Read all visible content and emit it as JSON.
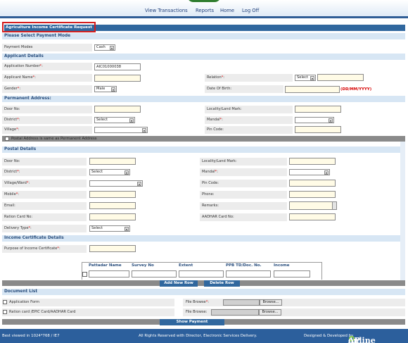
{
  "nav": {
    "view_transactions": "View Transactions",
    "reports": "Reports",
    "home": "Home",
    "log_off": "Log Off"
  },
  "page_title": "Agriculture Income Certificate Request",
  "payment": {
    "section": "Please Select Payment Mode",
    "mode_label": "Payment Modes",
    "mode_value": "Cash"
  },
  "applicant": {
    "section": "Applicant Details",
    "app_number_label": "Application Number",
    "app_number_value": "AIC01000038",
    "name_label": "Applicant Name",
    "relation_label": "Relation",
    "relation_value": "Select",
    "gender_label": "Gender",
    "gender_value": "Male",
    "dob_label": "Date Of Birth:",
    "dob_hint": "(DD/MM/YYYY)"
  },
  "permanent": {
    "section": "Permanent Address:",
    "door_label": "Door No:",
    "locality_label": "Locality/Land Mark:",
    "district_label": "District",
    "district_value": "Select",
    "mandal_label": "Mandal",
    "village_label": "Village",
    "pin_label": "Pin Code:",
    "same_as_label": "Postal Address is same as Permanent Address"
  },
  "postal": {
    "section": "Postal Details",
    "door_label": "Door No:",
    "locality_label": "Locality/Land Mark:",
    "district_label": "District",
    "district_value": "Select",
    "mandal_label": "Mandal",
    "village_label": "Village/Ward",
    "pin_label": "Pin Code:",
    "mobile_label": "Mobile",
    "phone_label": "Phone:",
    "email_label": "Email:",
    "remarks_label": "Remarks:",
    "ration_label": "Ration Card No:",
    "aadhar_label": "AADHAR Card No:",
    "delivery_label": "Delivery Type",
    "delivery_value": "Select"
  },
  "income": {
    "section": "Income Certificate Details",
    "purpose_label": "Purpose of Income Certificate",
    "columns": [
      "Pattadar Name",
      "Survey No",
      "Extent",
      "PPB TD/Doc. No.",
      "Income"
    ],
    "add_row": "Add New Row",
    "delete_row": "Delete Row"
  },
  "documents": {
    "section": "Document List",
    "items": [
      {
        "name": "Application Form",
        "file_label": "File Browse",
        "required": true,
        "browse": "Browse..."
      },
      {
        "name": "Ration card /EPIC Card/AADHAR Card",
        "file_label": "File Browse:",
        "required": false,
        "browse": "Browse..."
      }
    ]
  },
  "show_payment": "Show Payment",
  "required_mark": "*",
  "colon": ":",
  "footer": {
    "left": "Best viewed in 1024*768 / IE7",
    "center": "All Rights Reserved with Director, Electronic Services Delivery.",
    "right": "Designed & Developed by",
    "brand_prefix": "AP",
    "brand": "online"
  },
  "colors": {
    "header_blue": "#30679e",
    "section_bg": "#d7e6f4",
    "required_red": "#d60000",
    "input_yellow": "#fffbe6"
  }
}
